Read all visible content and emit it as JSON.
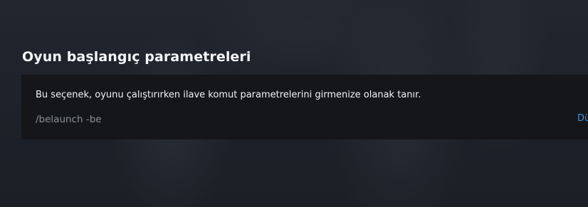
{
  "section": {
    "title": "Oyun başlangıç parametreleri"
  },
  "panel": {
    "description": "Bu seçenek, oyunu çalıştırırken ilave komut parametrelerini girmenize olanak tanır.",
    "params_value": "/belaunch -be",
    "edit_label": "Dü"
  }
}
